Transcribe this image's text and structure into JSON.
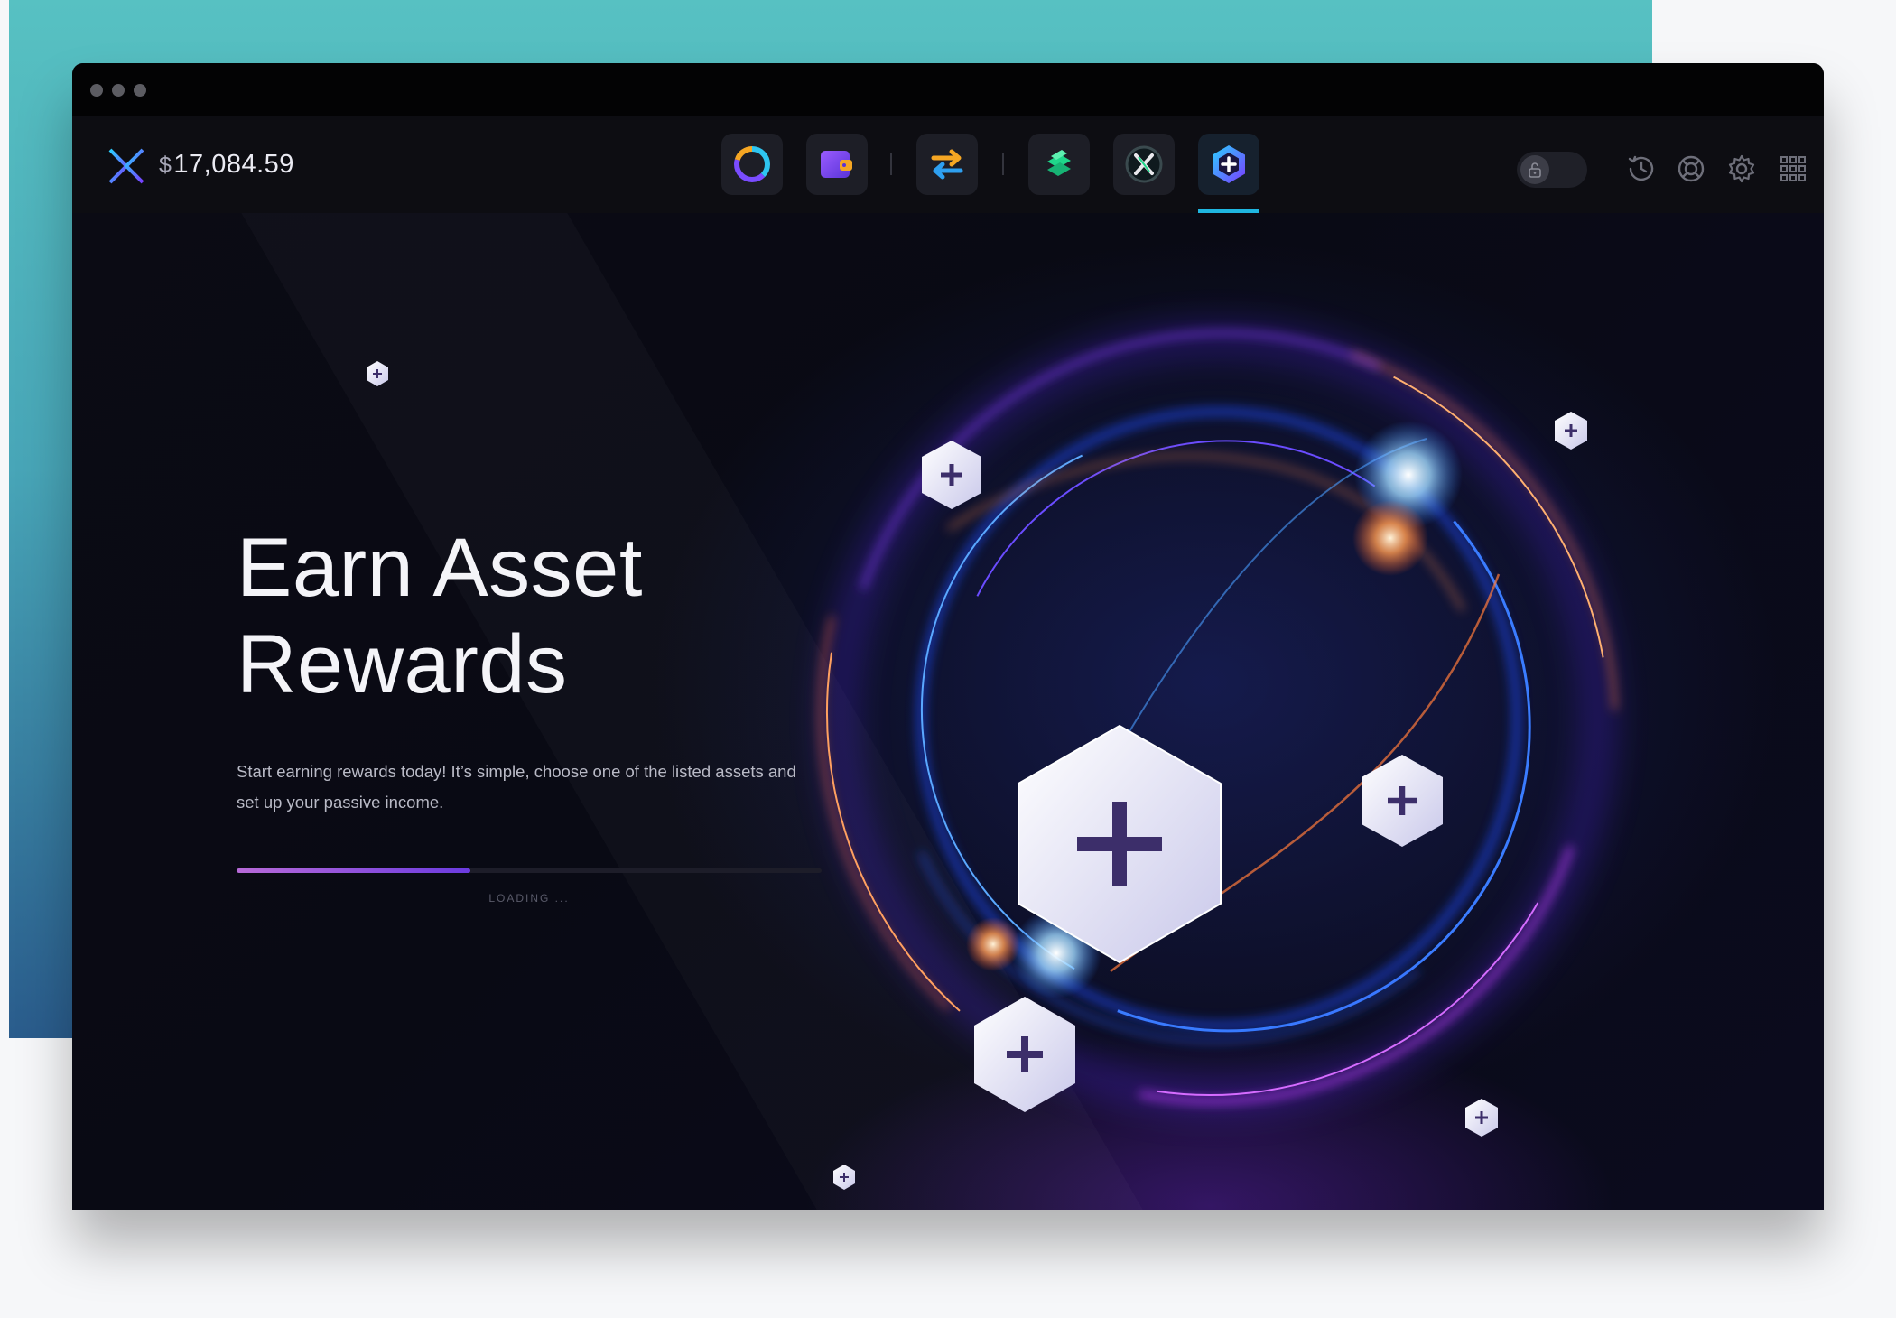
{
  "window": {
    "controls": [
      "close",
      "minimize",
      "maximize"
    ]
  },
  "header": {
    "logo": "exodus-logo",
    "balance": {
      "currency_symbol": "$",
      "amount": "17,084.59"
    },
    "apps": [
      {
        "name": "portfolio",
        "icon": "portfolio-ring-icon"
      },
      {
        "name": "wallet",
        "icon": "wallet-icon"
      },
      {
        "name": "exchange",
        "icon": "exchange-arrows-icon"
      },
      {
        "name": "compound",
        "icon": "compound-icon"
      },
      {
        "name": "x-app",
        "icon": "x-coin-icon"
      },
      {
        "name": "rewards",
        "icon": "rewards-hex-icon",
        "active": true
      }
    ],
    "right_controls": [
      "lock-toggle",
      "history-icon",
      "help-icon",
      "settings-icon",
      "apps-grid-icon"
    ]
  },
  "hero": {
    "title_line1": "Earn Asset",
    "title_line2": "Rewards",
    "subtitle_line1": "Start earning rewards today! It’s simple, choose one of the listed assets and",
    "subtitle_line2": "set up your passive income.",
    "progress": 0.4,
    "loading_label": "LOADING ..."
  },
  "colors": {
    "accent_tab": "#1fb6e0",
    "progress_start": "#b86ad8",
    "progress_end": "#6b3be0",
    "background": "#0c0c12"
  }
}
